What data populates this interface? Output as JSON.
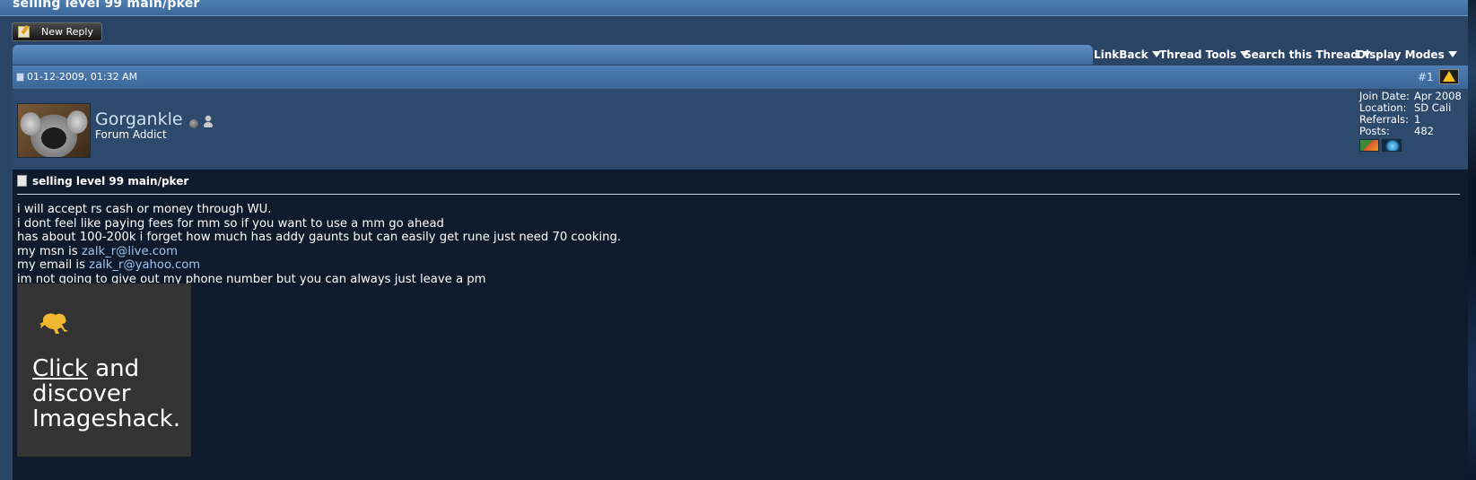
{
  "thread": {
    "title": "selling level 99 main/pker"
  },
  "toolbar": {
    "new_reply_label": "New Reply",
    "menus": [
      "LinkBack",
      "Thread Tools",
      "Search this Thread",
      "Display Modes"
    ]
  },
  "post": {
    "date": "01-12-2009, 01:32 AM",
    "number": "#1",
    "title": "selling level 99 main/pker",
    "author": {
      "username": "Gorgankle",
      "usertitle": "Forum Addict",
      "join_date_label": "Join Date:",
      "join_date": "Apr 2008",
      "location_label": "Location:",
      "location": "SD Cali",
      "referrals_label": "Referrals:",
      "referrals": "1",
      "posts_label": "Posts:",
      "posts": "482"
    },
    "lines": {
      "l1": "i will accept rs cash or money through WU.",
      "l2": "i dont feel like paying fees for mm so if you want to use a mm go ahead",
      "l3": "has about 100-200k i forget how much has addy gaunts but can easily get rune just need 70 cooking.",
      "l4_prefix": "my msn is ",
      "l4_link": "zalk_r@live.com",
      "l5_prefix": "my email is ",
      "l5_link": "zalk_r@yahoo.com",
      "l6": "im not going to give out my phone number but you can always just leave a pm"
    },
    "promo": {
      "click": "Click",
      "rest1": " and",
      "line2": "discover",
      "line3": "Imageshack."
    }
  },
  "colors": {
    "header_blue": "#4f7eb3",
    "user_area": "#2d4a6d",
    "post_body": "#0f1b2c",
    "link": "#9ec2ee",
    "frog": "#f0b830"
  }
}
